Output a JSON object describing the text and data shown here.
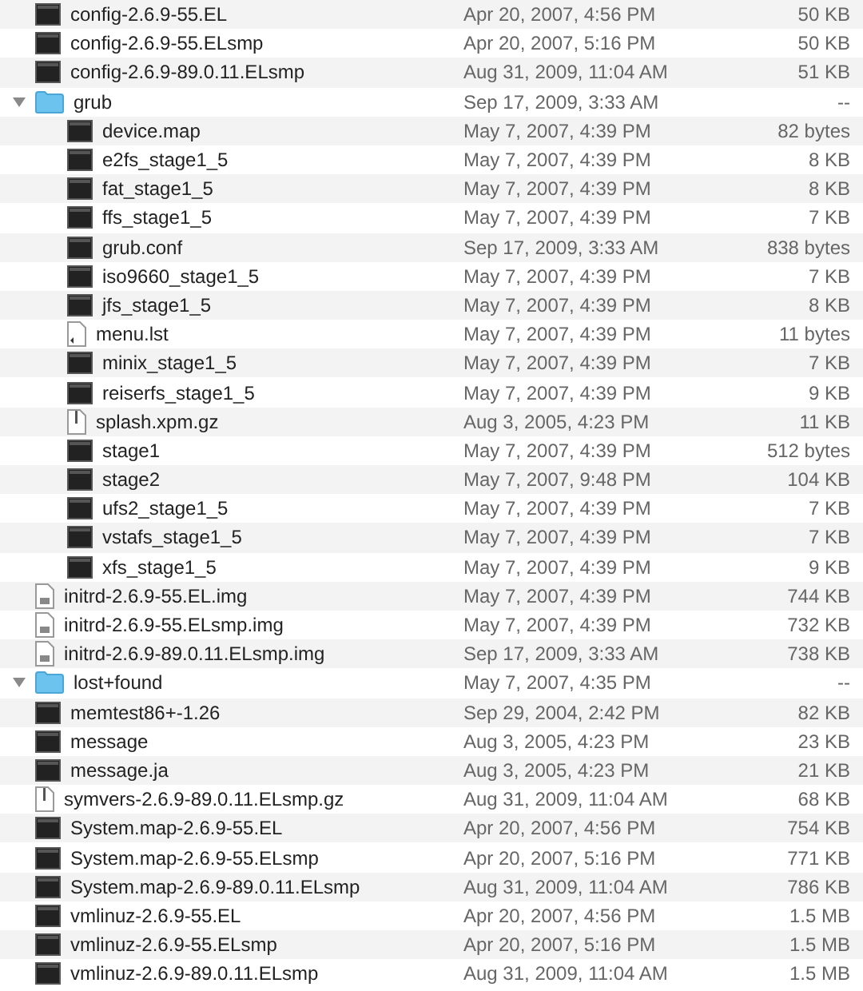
{
  "files": [
    {
      "name": "config-2.6.9-55.EL",
      "kind": "exec",
      "date": "Apr 20, 2007, 4:56 PM",
      "size": "50 KB"
    },
    {
      "name": "config-2.6.9-55.ELsmp",
      "kind": "exec",
      "date": "Apr 20, 2007, 5:16 PM",
      "size": "50 KB"
    },
    {
      "name": "config-2.6.9-89.0.11.ELsmp",
      "kind": "exec",
      "date": "Aug 31, 2009, 11:04 AM",
      "size": "51 KB"
    },
    {
      "name": "grub",
      "kind": "folder",
      "expanded": true,
      "date": "Sep 17, 2009, 3:33 AM",
      "size": "--",
      "children": [
        {
          "name": "device.map",
          "kind": "exec",
          "date": "May 7, 2007, 4:39 PM",
          "size": "82 bytes"
        },
        {
          "name": "e2fs_stage1_5",
          "kind": "exec",
          "date": "May 7, 2007, 4:39 PM",
          "size": "8 KB"
        },
        {
          "name": "fat_stage1_5",
          "kind": "exec",
          "date": "May 7, 2007, 4:39 PM",
          "size": "8 KB"
        },
        {
          "name": "ffs_stage1_5",
          "kind": "exec",
          "date": "May 7, 2007, 4:39 PM",
          "size": "7 KB"
        },
        {
          "name": "grub.conf",
          "kind": "exec",
          "date": "Sep 17, 2009, 3:33 AM",
          "size": "838 bytes"
        },
        {
          "name": "iso9660_stage1_5",
          "kind": "exec",
          "date": "May 7, 2007, 4:39 PM",
          "size": "7 KB"
        },
        {
          "name": "jfs_stage1_5",
          "kind": "exec",
          "date": "May 7, 2007, 4:39 PM",
          "size": "8 KB"
        },
        {
          "name": "menu.lst",
          "kind": "alias",
          "date": "May 7, 2007, 4:39 PM",
          "size": "11 bytes"
        },
        {
          "name": "minix_stage1_5",
          "kind": "exec",
          "date": "May 7, 2007, 4:39 PM",
          "size": "7 KB"
        },
        {
          "name": "reiserfs_stage1_5",
          "kind": "exec",
          "date": "May 7, 2007, 4:39 PM",
          "size": "9 KB"
        },
        {
          "name": "splash.xpm.gz",
          "kind": "archive",
          "date": "Aug 3, 2005, 4:23 PM",
          "size": "11 KB"
        },
        {
          "name": "stage1",
          "kind": "exec",
          "date": "May 7, 2007, 4:39 PM",
          "size": "512 bytes"
        },
        {
          "name": "stage2",
          "kind": "exec",
          "date": "May 7, 2007, 9:48 PM",
          "size": "104 KB"
        },
        {
          "name": "ufs2_stage1_5",
          "kind": "exec",
          "date": "May 7, 2007, 4:39 PM",
          "size": "7 KB"
        },
        {
          "name": "vstafs_stage1_5",
          "kind": "exec",
          "date": "May 7, 2007, 4:39 PM",
          "size": "7 KB"
        },
        {
          "name": "xfs_stage1_5",
          "kind": "exec",
          "date": "May 7, 2007, 4:39 PM",
          "size": "9 KB"
        }
      ]
    },
    {
      "name": "initrd-2.6.9-55.EL.img",
      "kind": "image",
      "date": "May 7, 2007, 4:39 PM",
      "size": "744 KB"
    },
    {
      "name": "initrd-2.6.9-55.ELsmp.img",
      "kind": "image",
      "date": "May 7, 2007, 4:39 PM",
      "size": "732 KB"
    },
    {
      "name": "initrd-2.6.9-89.0.11.ELsmp.img",
      "kind": "image",
      "date": "Sep 17, 2009, 3:33 AM",
      "size": "738 KB"
    },
    {
      "name": "lost+found",
      "kind": "folder",
      "expanded": true,
      "date": "May 7, 2007, 4:35 PM",
      "size": "--"
    },
    {
      "name": "memtest86+-1.26",
      "kind": "exec",
      "date": "Sep 29, 2004, 2:42 PM",
      "size": "82 KB"
    },
    {
      "name": "message",
      "kind": "exec",
      "date": "Aug 3, 2005, 4:23 PM",
      "size": "23 KB"
    },
    {
      "name": "message.ja",
      "kind": "exec",
      "date": "Aug 3, 2005, 4:23 PM",
      "size": "21 KB"
    },
    {
      "name": "symvers-2.6.9-89.0.11.ELsmp.gz",
      "kind": "archive",
      "date": "Aug 31, 2009, 11:04 AM",
      "size": "68 KB"
    },
    {
      "name": "System.map-2.6.9-55.EL",
      "kind": "exec",
      "date": "Apr 20, 2007, 4:56 PM",
      "size": "754 KB"
    },
    {
      "name": "System.map-2.6.9-55.ELsmp",
      "kind": "exec",
      "date": "Apr 20, 2007, 5:16 PM",
      "size": "771 KB"
    },
    {
      "name": "System.map-2.6.9-89.0.11.ELsmp",
      "kind": "exec",
      "date": "Aug 31, 2009, 11:04 AM",
      "size": "786 KB"
    },
    {
      "name": "vmlinuz-2.6.9-55.EL",
      "kind": "exec",
      "date": "Apr 20, 2007, 4:56 PM",
      "size": "1.5 MB"
    },
    {
      "name": "vmlinuz-2.6.9-55.ELsmp",
      "kind": "exec",
      "date": "Apr 20, 2007, 5:16 PM",
      "size": "1.5 MB"
    },
    {
      "name": "vmlinuz-2.6.9-89.0.11.ELsmp",
      "kind": "exec",
      "date": "Aug 31, 2009, 11:04 AM",
      "size": "1.5 MB"
    }
  ]
}
